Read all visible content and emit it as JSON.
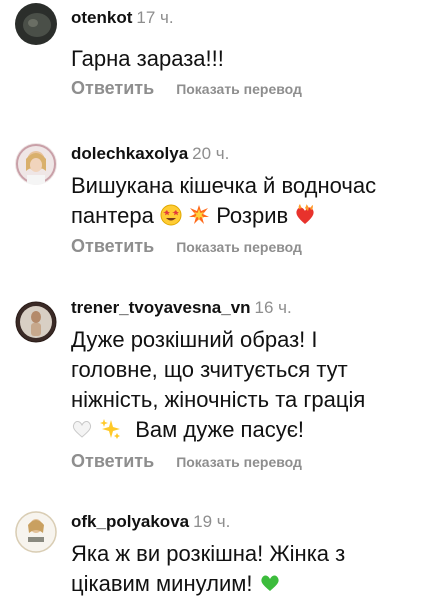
{
  "comments": [
    {
      "username": "otenkot",
      "time": "17 ч.",
      "text": "Гарна зараза!!!",
      "reply_label": "Ответить",
      "translate_label": "Показать перевод"
    },
    {
      "username": "dolechkaxolya",
      "time": "20 ч.",
      "text_line1": "Вишукана кішечка й водночас",
      "text_line2a": "пантера",
      "text_line2b": "Розрив",
      "reply_label": "Ответить",
      "translate_label": "Показать перевод"
    },
    {
      "username": "trener_tvoyavesna_vn",
      "time": "16 ч.",
      "text_line1": "Дуже розкішний образ! І",
      "text_line2": "головне, що зчитується тут",
      "text_line3": "ніжність, жіночність та грація",
      "text_line4": "Вам дуже пасує!",
      "reply_label": "Ответить",
      "translate_label": "Показать перевод"
    },
    {
      "username": "ofk_polyakova",
      "time": "19 ч.",
      "text_line1": "Яка ж ви розкішна! Жінка з",
      "text_line2": "цікавим минулим!"
    }
  ],
  "icons": {
    "emoji_star_struck": "star-struck-emoji",
    "emoji_collision": "collision-emoji",
    "emoji_heart_on_fire": "heart-on-fire-emoji",
    "emoji_white_heart": "white-heart-emoji",
    "emoji_sparkles": "sparkles-emoji",
    "emoji_green_heart": "green-heart-emoji"
  },
  "colors": {
    "secondary_text": "#8e8e8e",
    "primary_text": "#111111",
    "green_heart": "#3cbc3c"
  }
}
